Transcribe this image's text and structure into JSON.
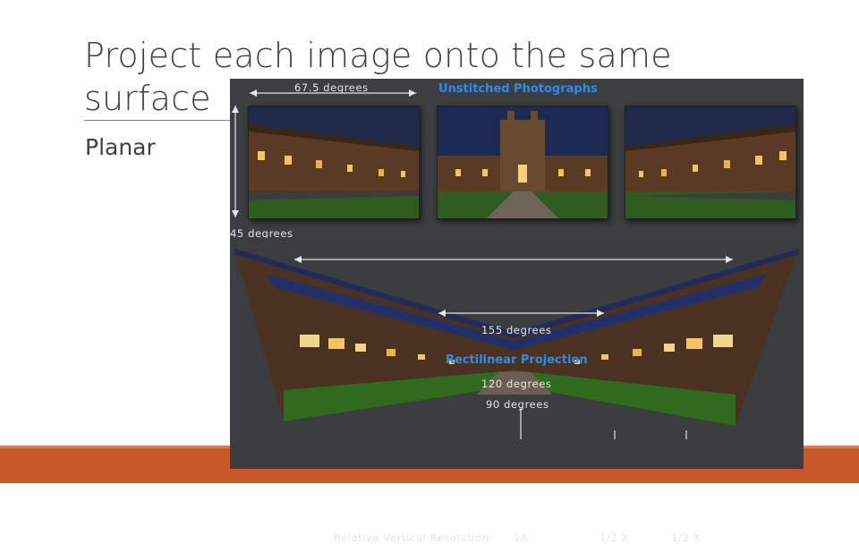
{
  "slide": {
    "title": "Project each image onto the same surface",
    "bullet": "Planar",
    "accent_color": "#c8582a"
  },
  "figure": {
    "top_angle": "67.5 degrees",
    "side_angle": "45 degrees",
    "unstitched_title": "Unstitched Photographs",
    "wide_angle": "155 degrees",
    "projection_title": "Rectilinear Projection",
    "mid_angle": "120 degrees",
    "inner_angle": "90 degrees",
    "resolution_label": "Relative Vertical Resolution:",
    "res_1": "1X",
    "res_2": "1/2 X",
    "res_3": "1/3 X"
  }
}
